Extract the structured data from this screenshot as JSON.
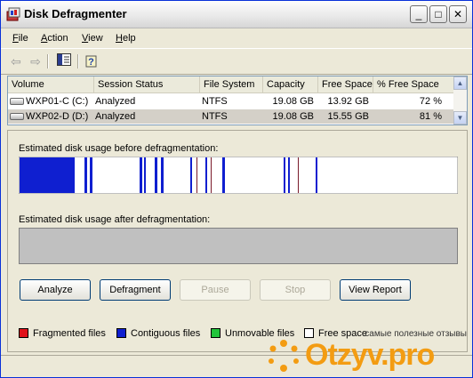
{
  "window": {
    "title": "Disk Defragmenter",
    "controls": {
      "minimize": "_",
      "maximize": "□",
      "close": "✕"
    }
  },
  "menu": [
    "File",
    "Action",
    "View",
    "Help"
  ],
  "menu_accel": [
    "F",
    "A",
    "V",
    "H"
  ],
  "menu_rest": [
    "ile",
    "ction",
    "iew",
    "elp"
  ],
  "toolbar": {
    "back": "⇦",
    "forward": "⇨"
  },
  "volumes": {
    "headers": [
      "Volume",
      "Session Status",
      "File System",
      "Capacity",
      "Free Space",
      "% Free Space"
    ],
    "rows": [
      {
        "volume": "WXP01-C (C:)",
        "status": "Analyzed",
        "fs": "NTFS",
        "capacity": "19.08 GB",
        "free": "13.92 GB",
        "pct": "72 %"
      },
      {
        "volume": "WXP02-D (D:)",
        "status": "Analyzed",
        "fs": "NTFS",
        "capacity": "19.08 GB",
        "free": "15.55 GB",
        "pct": "81 %"
      }
    ]
  },
  "before_label": "Estimated disk usage before defragmentation:",
  "after_label": "Estimated disk usage after defragmentation:",
  "buttons": {
    "analyze": "Analyze",
    "defragment": "Defragment",
    "pause": "Pause",
    "stop": "Stop",
    "view_report": "View Report"
  },
  "legend": {
    "fragmented": "Fragmented files",
    "contiguous": "Contiguous files",
    "unmovable": "Unmovable files",
    "free": "Free space"
  },
  "colors": {
    "fragmented": "#e0121a",
    "contiguous": "#0f1fd0",
    "unmovable": "#21c43a",
    "free": "#ffffff",
    "after_map": "#c0c0c0"
  },
  "watermark": {
    "tagline": "самые полезные отзывы",
    "brand": "Otzyv.pro"
  }
}
